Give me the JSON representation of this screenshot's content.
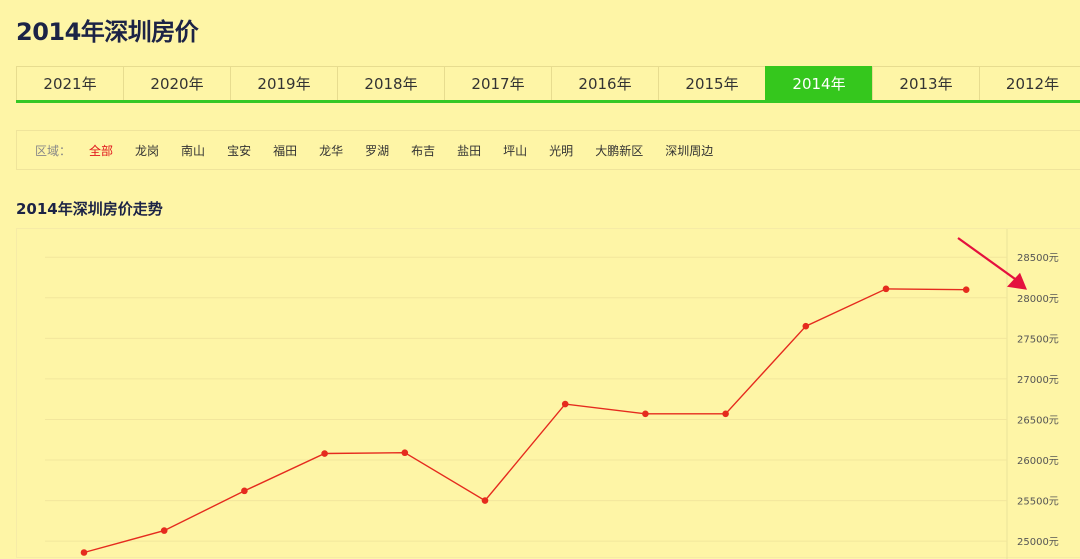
{
  "page": {
    "title": "2014年深圳房价"
  },
  "year_tabs": {
    "items": [
      "2021年",
      "2020年",
      "2019年",
      "2018年",
      "2017年",
      "2016年",
      "2015年",
      "2014年",
      "2013年",
      "2012年"
    ],
    "active": "2014年"
  },
  "districts": {
    "label": "区域：",
    "items": [
      "全部",
      "龙岗",
      "南山",
      "宝安",
      "福田",
      "龙华",
      "罗湖",
      "布吉",
      "盐田",
      "坪山",
      "光明",
      "大鹏新区",
      "深圳周边"
    ],
    "active": "全部"
  },
  "colors": {
    "accent_green": "#35c71d",
    "active_district": "#e0131b",
    "line": "#e52b1e",
    "arrow": "#e4113e"
  },
  "chart_data": {
    "type": "line",
    "title": "2014年深圳房价走势",
    "xlabel": "",
    "ylabel": "",
    "x": [
      1,
      2,
      3,
      4,
      5,
      6,
      7,
      8,
      9,
      10,
      11,
      12
    ],
    "series": [
      {
        "values": [
          24860,
          25130,
          25620,
          26080,
          26090,
          25500,
          26690,
          26570,
          26570,
          27650,
          28110,
          28100
        ]
      }
    ],
    "yticks": [
      "25000元",
      "25500元",
      "26000元",
      "26500元",
      "27000元",
      "27500元",
      "28000元",
      "28500元"
    ],
    "ylim": [
      24780,
      28700
    ],
    "grid": true,
    "y_axis_position": "right",
    "annotation": "arrow pointing at 28000元 tick"
  }
}
